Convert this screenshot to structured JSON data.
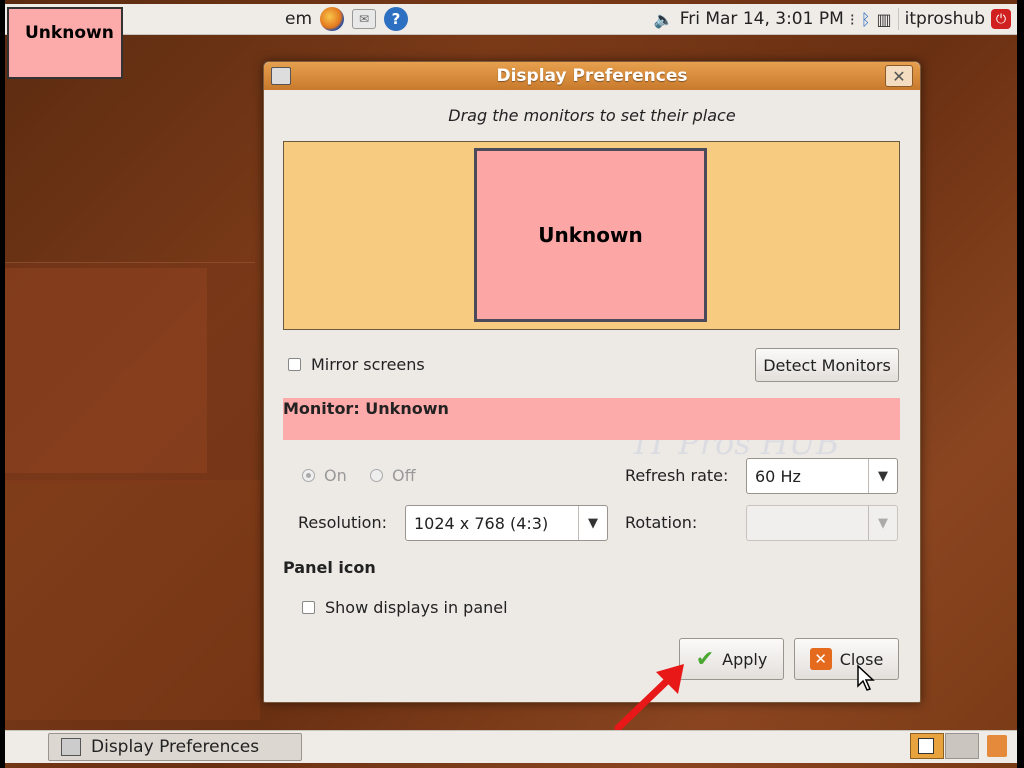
{
  "top_panel": {
    "menu_fragment": "em",
    "datetime": "Fri Mar 14,  3:01 PM",
    "user": "itproshub"
  },
  "unknown_tag": "Unknown",
  "dialog": {
    "title": "Display Preferences",
    "instruction": "Drag the monitors to set their place",
    "monitor_name": "Unknown",
    "mirror_label": "Mirror screens",
    "detect_label": "Detect Monitors",
    "monitor_heading": "Monitor: Unknown",
    "on_label": "On",
    "off_label": "Off",
    "refresh_label": "Refresh rate:",
    "refresh_value": "60 Hz",
    "resolution_label": "Resolution:",
    "resolution_value": "1024 x 768 (4:3)",
    "rotation_label": "Rotation:",
    "rotation_value": "",
    "panel_icon_heading": "Panel icon",
    "show_displays_label": "Show displays in panel",
    "apply_label": "Apply",
    "close_label": "Close"
  },
  "watermark": "IT Pros HUB",
  "taskbar": {
    "window_label": "Display Preferences"
  },
  "colors": {
    "arrange_bg": "#f8cc80",
    "monitor_fill": "#fca6a6",
    "titlebar": "#d98a3a",
    "annotation_arrow": "#e81818"
  }
}
